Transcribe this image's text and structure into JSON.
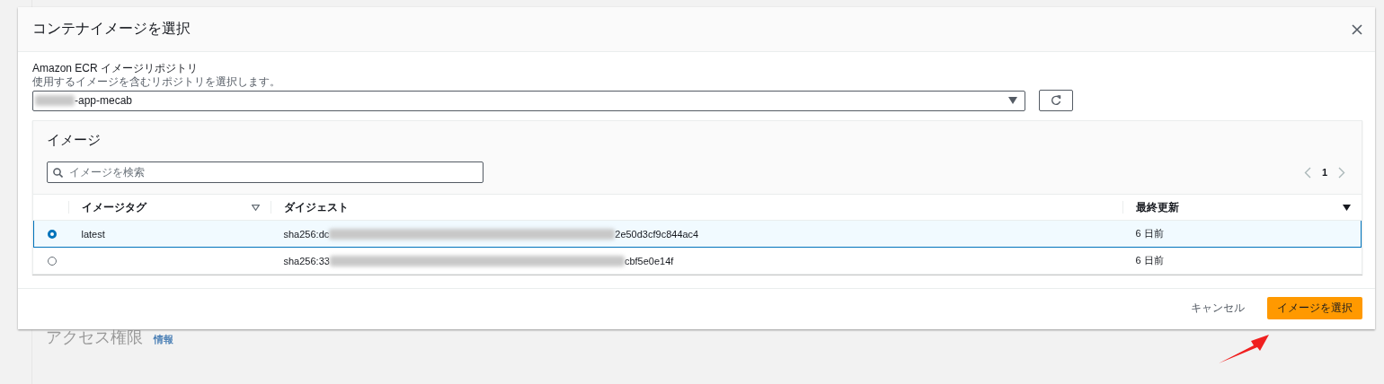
{
  "background": {
    "section_title": "アクセス権限",
    "info_link": "情報"
  },
  "dialog": {
    "title": "コンテナイメージを選択",
    "repository": {
      "label": "Amazon ECR イメージリポジトリ",
      "description": "使用するイメージを含むリポジトリを選択します。",
      "value": "-app-mecab"
    },
    "images": {
      "title": "イメージ",
      "search": {
        "placeholder": "イメージを検索"
      },
      "page": "1",
      "columns": [
        "イメージタグ",
        "ダイジェスト",
        "最終更新"
      ],
      "rows": [
        {
          "selected": true,
          "tag": "latest",
          "digest_start": "sha256:dc",
          "digest_end": "2e50d3cf9c844ac4",
          "updated": "6 日前"
        },
        {
          "selected": false,
          "digest_start": "sha256:33",
          "digest_end": "cbf5e0e14f",
          "updated": "6 日前"
        }
      ]
    },
    "buttons": [
      {
        "label": "キャンセル",
        "kind": "link"
      },
      {
        "label": "イメージを選択",
        "kind": "primary"
      }
    ]
  }
}
